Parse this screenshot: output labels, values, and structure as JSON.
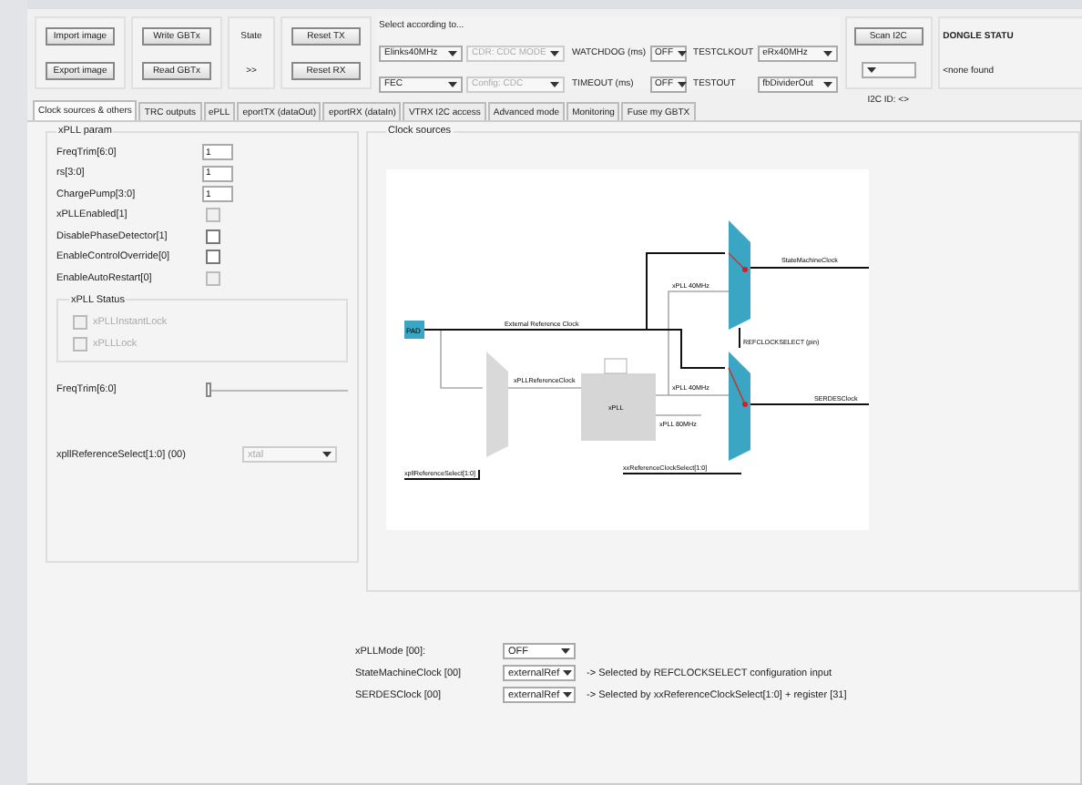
{
  "toolbar": {
    "image_buttons": [
      "Import image",
      "Export image"
    ],
    "gbtx_buttons": [
      "Write GBTx",
      "Read GBTx"
    ],
    "state": {
      "label": "State",
      "value": ">>"
    },
    "reset_buttons": [
      "Reset TX",
      "Reset RX"
    ],
    "select_label": "Select according to...",
    "selects": [
      {
        "value": "Elinks40MHz",
        "disabled": false
      },
      {
        "value": "FEC",
        "disabled": false
      }
    ],
    "cdc_selects": [
      {
        "value": "CDR: CDC MODE",
        "disabled": true
      },
      {
        "value": "Config: CDC",
        "disabled": true
      }
    ],
    "timer_fields": [
      {
        "label": "WATCHDOG (ms)",
        "value": "OFF"
      },
      {
        "label": "TIMEOUT (ms)",
        "value": "OFF"
      }
    ],
    "test_fields": [
      {
        "label": "TESTCLKOUT",
        "value": "eRx40MHz"
      },
      {
        "label": "TESTOUT",
        "value": "fbDividerOut"
      }
    ],
    "scan_button": "Scan I2C",
    "i2c_label": "I2C ID: <>",
    "dongle": {
      "title": "DONGLE STATU",
      "value": "<none found"
    }
  },
  "tabs": [
    {
      "label": "Clock sources & others",
      "selected": true
    },
    {
      "label": "TRC outputs",
      "selected": false
    },
    {
      "label": "ePLL",
      "selected": false
    },
    {
      "label": "eportTX (dataOut)",
      "selected": false
    },
    {
      "label": "eportRX (dataIn)",
      "selected": false
    },
    {
      "label": "VTRX I2C access",
      "selected": false
    },
    {
      "label": "Advanced mode",
      "selected": false
    },
    {
      "label": "Monitoring",
      "selected": false
    },
    {
      "label": "Fuse my GBTX",
      "selected": false
    }
  ],
  "xpll_param": {
    "title": "xPLL param",
    "rows": [
      {
        "kind": "input",
        "label": "FreqTrim[6:0]",
        "value": "1"
      },
      {
        "kind": "input",
        "label": "rs[3:0]",
        "value": "1"
      },
      {
        "kind": "input",
        "label": "ChargePump[3:0]",
        "value": "1"
      },
      {
        "kind": "checkbox",
        "label": "xPLLEnabled[1]",
        "checked": false,
        "disabled": true
      },
      {
        "kind": "checkbox",
        "label": "DisablePhaseDetector[1]",
        "checked": false,
        "disabled": false
      },
      {
        "kind": "checkbox",
        "label": "EnableControlOverride[0]",
        "checked": false,
        "disabled": false
      },
      {
        "kind": "checkbox",
        "label": "EnableAutoRestart[0]",
        "checked": false,
        "disabled": true
      }
    ],
    "status": {
      "title": "xPLL Status",
      "items": [
        {
          "label": "xPLLInstantLock",
          "checked": false
        },
        {
          "label": "xPLLLock",
          "checked": false
        }
      ]
    },
    "slider": {
      "label": "FreqTrim[6:0]",
      "level": 0
    },
    "ref_select": {
      "label": "xpllReferenceSelect[1:0] (00)",
      "value": "xtal",
      "disabled": true
    }
  },
  "clock_sources": {
    "title": "Clock sources",
    "diagram": {
      "pad": "PAD",
      "ext_ref": "External Reference Clock",
      "pll_ref": "xPLLReferenceClock",
      "pll": "xPLL",
      "pll_out_upper": "xPLL 40MHz",
      "pll_out_lower": "xPLL 40MHz",
      "pll_out_80": "xPLL 80MHz",
      "ref_select": "xpllReferenceSelect[1:0]",
      "serdes_select": "xxReferenceClockSelect[1:0]",
      "sm_clock": "StateMachineClock",
      "refclock_pin": "REFCLOCKSELECT (pin)",
      "serdes_clock": "SERDESClock"
    }
  },
  "clock_settings": [
    {
      "label": "xPLLMode [00]:",
      "value": "OFF"
    },
    {
      "label": "StateMachineClock [00]",
      "value": "externalRef",
      "note": "-> Selected by REFCLOCKSELECT configuration input"
    },
    {
      "label": "SERDESClock [00]",
      "value": "externalRef",
      "note": "-> Selected by xxReferenceClockSelect[1:0] + register [31]"
    }
  ]
}
